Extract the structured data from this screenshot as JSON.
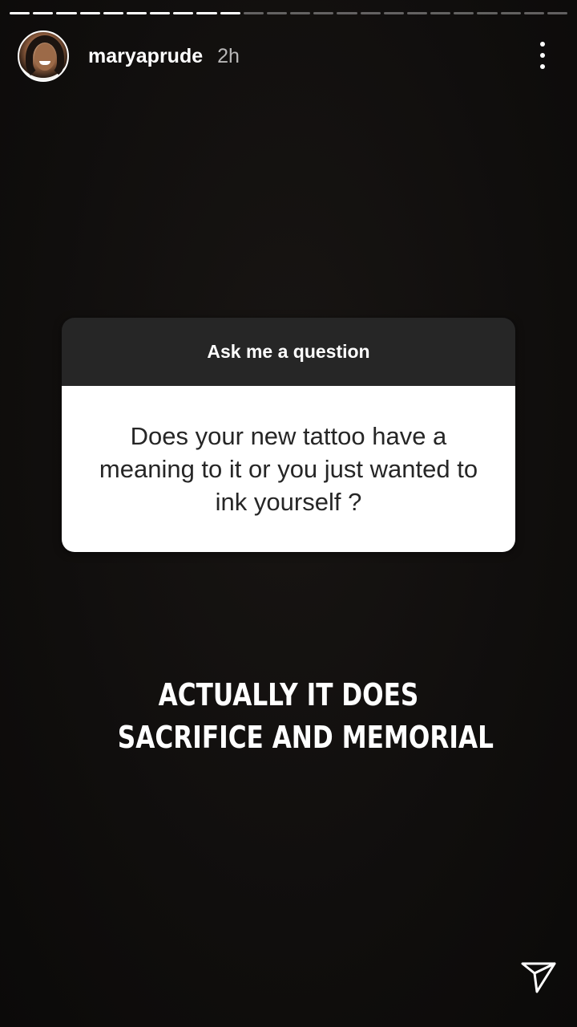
{
  "story": {
    "progress_segments": 24,
    "progress_done": 10
  },
  "header": {
    "username": "maryaprude",
    "time": "2h",
    "avatar_icon": "avatar",
    "more_icon": "more-vertical-icon"
  },
  "question_sticker": {
    "title": "Ask me a question",
    "question": "Does your new tattoo have a meaning to it or you just wanted to ink yourself ?"
  },
  "answer": {
    "line1": "ACTUALLY IT DOES",
    "line2": "SACRIFICE AND MEMORIAL"
  },
  "footer": {
    "send_icon": "send-icon"
  },
  "colors": {
    "background": "#0f0d0c",
    "sticker_header": "#262626",
    "sticker_body": "#ffffff",
    "text_light": "#ffffff"
  }
}
